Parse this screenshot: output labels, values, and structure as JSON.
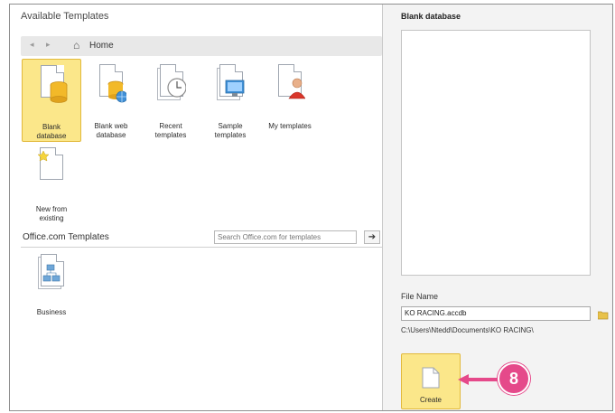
{
  "left": {
    "title": "Available Templates",
    "nav": {
      "back_icon": "back-arrow-icon",
      "forward_icon": "forward-arrow-icon",
      "home_icon": "home-icon",
      "label": "Home"
    },
    "templates": [
      {
        "label": "Blank\ndatabase",
        "icon": "blank-database-icon",
        "selected": true
      },
      {
        "label": "Blank web\ndatabase",
        "icon": "blank-web-database-icon",
        "selected": false
      },
      {
        "label": "Recent\ntemplates",
        "icon": "recent-templates-icon",
        "selected": false
      },
      {
        "label": "Sample\ntemplates",
        "icon": "sample-templates-icon",
        "selected": false
      },
      {
        "label": "My templates",
        "icon": "my-templates-icon",
        "selected": false
      },
      {
        "label": "New from\nexisting",
        "icon": "new-from-existing-icon",
        "selected": false
      }
    ],
    "office_section": {
      "label": "Office.com Templates",
      "search_placeholder": "Search Office.com for templates",
      "go_label": "➔"
    },
    "office_templates": [
      {
        "label": "Business",
        "icon": "business-folder-icon"
      }
    ]
  },
  "right": {
    "title": "Blank database",
    "file_name_label": "File Name",
    "file_name_value": "KO RACING.accdb",
    "path": "C:\\Users\\Ntedd\\Documents\\KO RACING\\",
    "create_label": "Create"
  },
  "callout": {
    "number": "8",
    "color": "#e5498a"
  },
  "colors": {
    "selected_bg": "#fbe78a",
    "selected_border": "#e2b93b"
  }
}
